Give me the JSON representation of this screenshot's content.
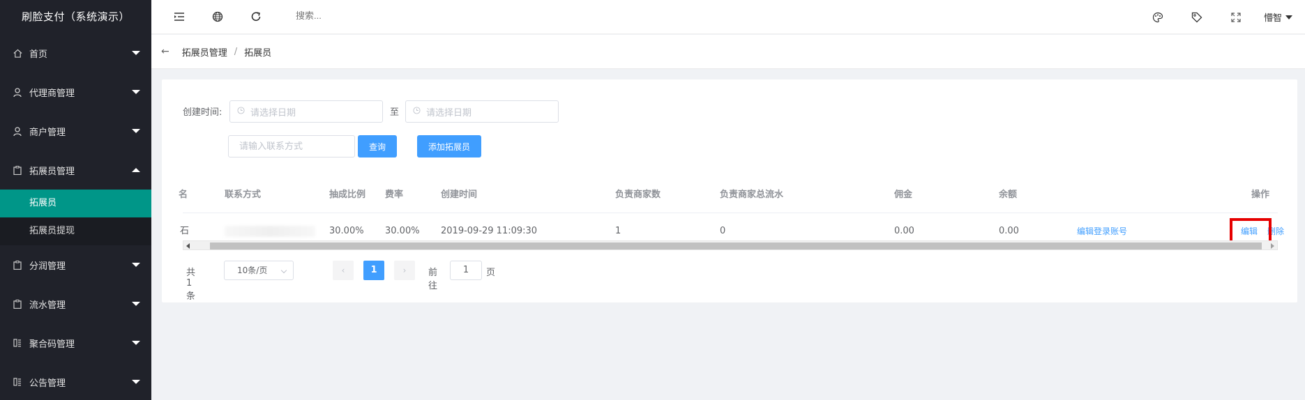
{
  "app": {
    "title": "刷脸支付（系统演示）"
  },
  "sidebar": {
    "items": [
      {
        "label": "首页",
        "icon": "home-icon",
        "expanded": false
      },
      {
        "label": "代理商管理",
        "icon": "user-icon",
        "expanded": false
      },
      {
        "label": "商户管理",
        "icon": "user-icon",
        "expanded": false
      },
      {
        "label": "拓展员管理",
        "icon": "clipboard-icon",
        "expanded": true,
        "children": [
          {
            "label": "拓展员",
            "active": true
          },
          {
            "label": "拓展员提现",
            "active": false
          }
        ]
      },
      {
        "label": "分润管理",
        "icon": "clipboard-icon",
        "expanded": false
      },
      {
        "label": "流水管理",
        "icon": "clipboard-icon",
        "expanded": false
      },
      {
        "label": "聚合码管理",
        "icon": "grid-icon",
        "expanded": false
      },
      {
        "label": "公告管理",
        "icon": "grid-icon",
        "expanded": false
      }
    ]
  },
  "header": {
    "search_placeholder": "搜索...",
    "user_name": "懵智",
    "icons": [
      "menu-fold-icon",
      "globe-icon",
      "refresh-icon",
      "palette-icon",
      "tag-icon",
      "fullscreen-icon"
    ]
  },
  "breadcrumb": {
    "items": [
      "拓展员管理",
      "拓展员"
    ]
  },
  "filters": {
    "created_label": "创建时间:",
    "date_placeholder_start": "请选择日期",
    "to_label": "至",
    "date_placeholder_end": "请选择日期",
    "contact_placeholder": "请输入联系方式",
    "query_button": "查询",
    "add_button": "添加拓展员"
  },
  "table": {
    "columns": [
      "名",
      "联系方式",
      "抽成比例",
      "费率",
      "创建时间",
      "负责商家数",
      "负责商家总流水",
      "佣金",
      "余额",
      "操作"
    ],
    "rows": [
      {
        "name": "石",
        "contact": "",
        "commission_ratio": "30.00%",
        "rate": "30.00%",
        "created": "2019-09-29 11:09:30",
        "merchant_count": "1",
        "merchant_flow": "0",
        "commission": "0.00",
        "balance": "0.00",
        "actions": {
          "edit_login": "编辑登录账号",
          "edit": "编辑",
          "delete": "删除"
        }
      }
    ]
  },
  "pagination": {
    "total": "共 1 条",
    "page_size": "10条/页",
    "current_page": "1",
    "goto_label": "前往",
    "goto_value": "1",
    "page_suffix": "页",
    "prev": "‹",
    "next": "›"
  },
  "colors": {
    "sidebar_bg": "#20222a",
    "active_item": "#009688",
    "primary": "#409eff",
    "highlight": "#e60000"
  }
}
